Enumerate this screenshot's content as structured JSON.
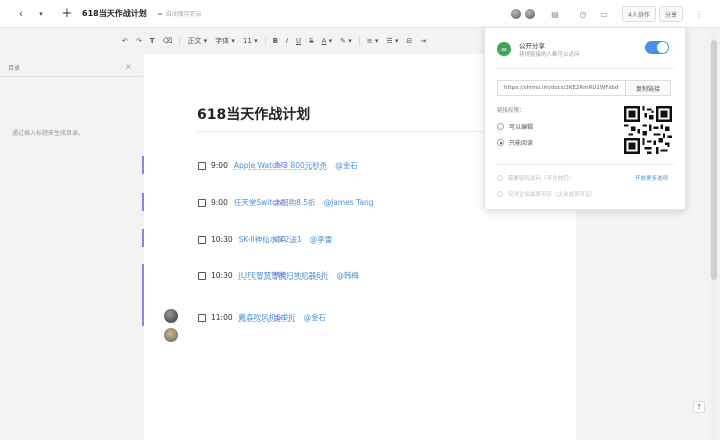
{
  "topbar": {
    "back_icon": "chevron-left-icon",
    "dropdown_icon": "chevron-down-icon",
    "add_icon": "plus-icon",
    "title": "618当天作战计划",
    "save_status": "自动保存到云",
    "collab_label": "4人协作",
    "share_label": "分享",
    "more_icon": "more-vertical-icon"
  },
  "format": {
    "undo": "↶",
    "redo": "↷",
    "style": "正文",
    "font": "字体",
    "size": "11",
    "bold": "B",
    "italic": "I",
    "underline": "U",
    "strike": "S",
    "color": "A",
    "highlight": "✎"
  },
  "sidebar": {
    "title": "目录",
    "empty_hint": "通过插入标题来生成目录。"
  },
  "document": {
    "heading": "618当天作战计划",
    "tasks": [
      {
        "time": "9:00",
        "text": "Apple Watch 3 800元秒杀",
        "mention": "@金石",
        "comment": "金石",
        "underline": true
      },
      {
        "time": "9:00",
        "text": "任天堂Switch回购8.5折",
        "mention": "@James Tang",
        "comment": "金石",
        "underline": false
      },
      {
        "time": "10:30",
        "text": "SK-II神仙水买2送1",
        "mention": "@李雷",
        "comment": "金石",
        "underline": false
      },
      {
        "time": "10:30",
        "text": "iLIFE智慧智能扫地机器6折",
        "mention": "@韩梅",
        "comment": "韩梅",
        "underline": true
      },
      {
        "time": "11:00",
        "text": "戴森吹风机6.0折",
        "mention": "@金石",
        "comment": "金石",
        "underline": false
      }
    ]
  },
  "share_panel": {
    "title": "公开分享",
    "subtitle": "获得链接的人都可以访问",
    "link": "https://shimo.im/docs/2KE2RmRU1WFsbd",
    "copy_label": "复制链接",
    "perm_label": "链接权限：",
    "perm_options": [
      "可以编辑",
      "只能阅读"
    ],
    "selected_perm": 1,
    "option1": "需要密码访问（不含他们）",
    "option2": "仅对企业成员可见（企业成员可见）",
    "advanced_label": "开放更多选项"
  },
  "colors": {
    "accent": "#4a90e2",
    "comment": "#6a64d8",
    "link": "#4a90d9",
    "share_icon": "#3ea65a"
  }
}
